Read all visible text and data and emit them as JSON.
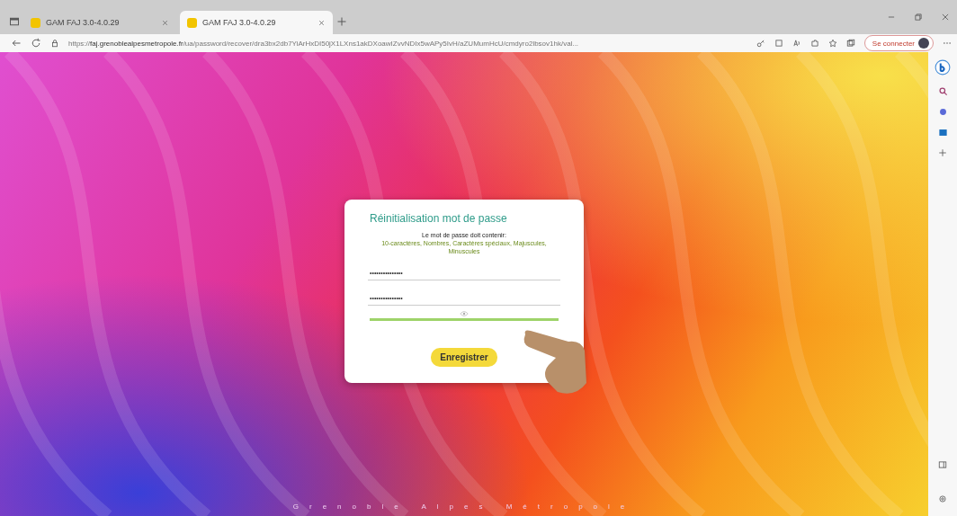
{
  "browser": {
    "tabs": [
      {
        "title": "GAM FAJ 3.0-4.0.29",
        "selected": false
      },
      {
        "title": "GAM FAJ 3.0-4.0.29",
        "selected": true
      }
    ],
    "url": "https://**faj.grenoblealpesmetropole.fr**/ua/password/recover/dra3bx2db7YiArHxDI50jX1LXns1akDXoawIZvvNDIx5wAPy5IvH/aZUMumHcU/cmdyro2lbsov1hk/val...",
    "sign_in": "Se connecter"
  },
  "dialog": {
    "title": "Réinitialisation mot de passe",
    "hint": "Le mot de passe doit contenir:",
    "requirements": "10-caractères, Nombres, Caractères spéciaux, Majuscules, Minuscules",
    "fields": [
      {
        "value": "•••••••••••••••"
      },
      {
        "value": "•••••••••••••••"
      }
    ],
    "strength": {
      "level": 1
    },
    "button": "Enregistrer"
  },
  "footer": "Grenoble Alpes Métropole"
}
